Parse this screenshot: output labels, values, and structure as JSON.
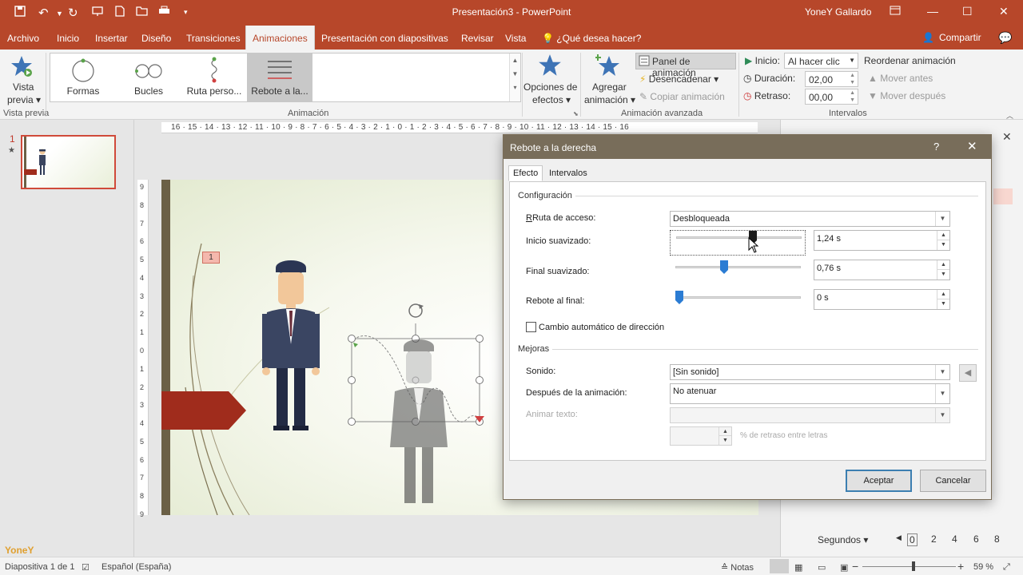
{
  "window": {
    "title": "Presentación3 - PowerPoint",
    "user": "YoneY Gallardo"
  },
  "tabs": [
    {
      "label": "Archivo"
    },
    {
      "label": "Inicio"
    },
    {
      "label": "Insertar"
    },
    {
      "label": "Diseño"
    },
    {
      "label": "Transiciones"
    },
    {
      "label": "Animaciones"
    },
    {
      "label": "Presentación con diapositivas"
    },
    {
      "label": "Revisar"
    },
    {
      "label": "Vista"
    },
    {
      "label": "¿Qué desea hacer?"
    }
  ],
  "share_label": "Compartir",
  "ribbon": {
    "preview_line1": "Vista",
    "preview_line2": "previa",
    "preview_group": "Vista previa",
    "gallery": [
      "Formas",
      "Bucles",
      "Ruta perso...",
      "Rebote a la..."
    ],
    "animation_group": "Animación",
    "effect_options_line1": "Opciones de",
    "effect_options_line2": "efectos",
    "add_anim_line1": "Agregar",
    "add_anim_line2": "animación",
    "anim_panel": "Panel de animación",
    "trigger": "Desencadenar",
    "copy_anim": "Copiar animación",
    "advanced_group": "Animación avanzada",
    "start_label": "Inicio:",
    "start_value": "Al hacer clic",
    "duration_label": "Duración:",
    "duration_value": "02,00",
    "delay_label": "Retraso:",
    "delay_value": "00,00",
    "reorder": "Reordenar animación",
    "move_before": "Mover antes",
    "move_after": "Mover después",
    "timing_group": "Intervalos"
  },
  "thumbnail": {
    "number": "1",
    "star": "★"
  },
  "slide": {
    "anim_tag": "1"
  },
  "ruler_h": "16 · 15 · 14 · 13 · 12 · 11 · 10 · 9 · 8 · 7 · 6 · 5 · 4 · 3 · 2 · 1 · 0 · 1 · 2 · 3 · 4 · 5 · 6 · 7 · 8 · 9 · 10 · 11 · 12 · 13 · 14 · 15 · 16",
  "ruler_v": [
    "9",
    "8",
    "7",
    "6",
    "5",
    "4",
    "3",
    "2",
    "1",
    "0",
    "1",
    "2",
    "3",
    "4",
    "5",
    "6",
    "7",
    "8",
    "9"
  ],
  "right_pane": {
    "seconds_label": "Segundos",
    "timeline": [
      "0",
      "2",
      "4",
      "6",
      "8"
    ]
  },
  "dialog": {
    "title": "Rebote a la derecha",
    "help": "?",
    "tab_effect": "Efecto",
    "tab_timing": "Intervalos",
    "section_settings": "Configuración",
    "path_label": "Ruta de acceso:",
    "path_value": "Desbloqueada",
    "smooth_start_label": "Inicio suavizado:",
    "smooth_start_value": "1,24 s",
    "smooth_end_label": "Final suavizado:",
    "smooth_end_value": "0,76 s",
    "bounce_end_label": "Rebote al final:",
    "bounce_end_value": "0 s",
    "auto_reverse_label": "Cambio automático de dirección",
    "section_enhance": "Mejoras",
    "sound_label": "Sonido:",
    "sound_value": "[Sin sonido]",
    "after_label": "Después de la animación:",
    "after_value": "No atenuar",
    "animate_text_label": "Animar texto:",
    "delay_letters_label": "% de retraso entre letras",
    "ok": "Aceptar",
    "cancel": "Cancelar",
    "smooth_start_fraction": 0.62,
    "smooth_end_fraction": 0.38,
    "bounce_end_fraction": 0.0
  },
  "status": {
    "slide_info": "Diapositiva 1 de 1",
    "language": "Español (España)",
    "notes": "Notas",
    "zoom": "59 %",
    "zoom_fraction": 0.55,
    "watermark": "YoneY"
  },
  "colors": {
    "brand": "#b7472a",
    "dialog_title": "#786d5a",
    "slider_thumb": "#2b7cd3"
  }
}
